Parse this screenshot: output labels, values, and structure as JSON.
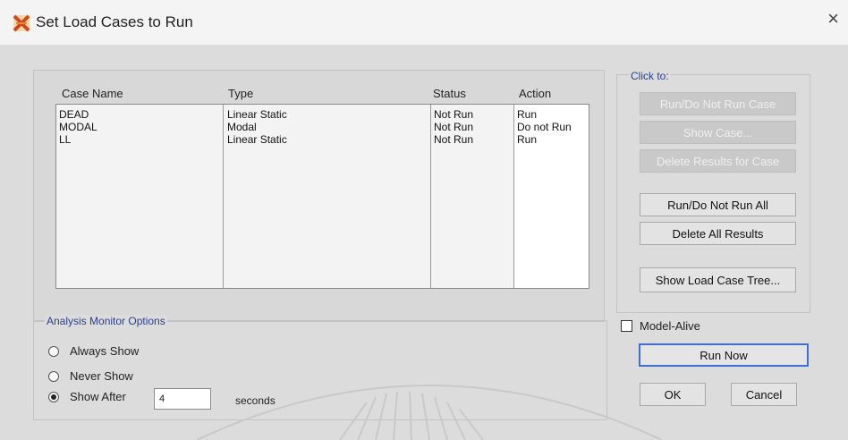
{
  "window": {
    "title": "Set Load Cases to Run",
    "close_glyph": "×",
    "app_icon": "sap-structure-icon"
  },
  "cases": {
    "headers": {
      "case_name": "Case Name",
      "type": "Type",
      "status": "Status",
      "action": "Action"
    },
    "rows": [
      {
        "case_name": "DEAD",
        "type": "Linear Static",
        "status": "Not Run",
        "action": "Run"
      },
      {
        "case_name": "MODAL",
        "type": "Modal",
        "status": "Not Run",
        "action": "Do not Run"
      },
      {
        "case_name": "LL",
        "type": "Linear Static",
        "status": "Not Run",
        "action": "Run"
      }
    ]
  },
  "click_to": {
    "label": "Click to:",
    "buttons": {
      "run_do_not_run_case": "Run/Do Not Run Case",
      "show_case": "Show Case...",
      "delete_results_for_case": "Delete Results for Case",
      "run_do_not_run_all": "Run/Do Not Run All",
      "delete_all_results": "Delete All Results",
      "show_load_case_tree": "Show Load Case Tree..."
    }
  },
  "monitor": {
    "label": "Analysis Monitor Options",
    "options": [
      {
        "label": "Always Show",
        "selected": false
      },
      {
        "label": "Never Show",
        "selected": false
      },
      {
        "label": "Show After",
        "selected": true
      }
    ],
    "seconds_value": "4",
    "seconds_label": "seconds"
  },
  "model_alive": {
    "label": "Model-Alive",
    "checked": false
  },
  "actions": {
    "run_now": "Run Now",
    "ok": "OK",
    "cancel": "Cancel"
  }
}
